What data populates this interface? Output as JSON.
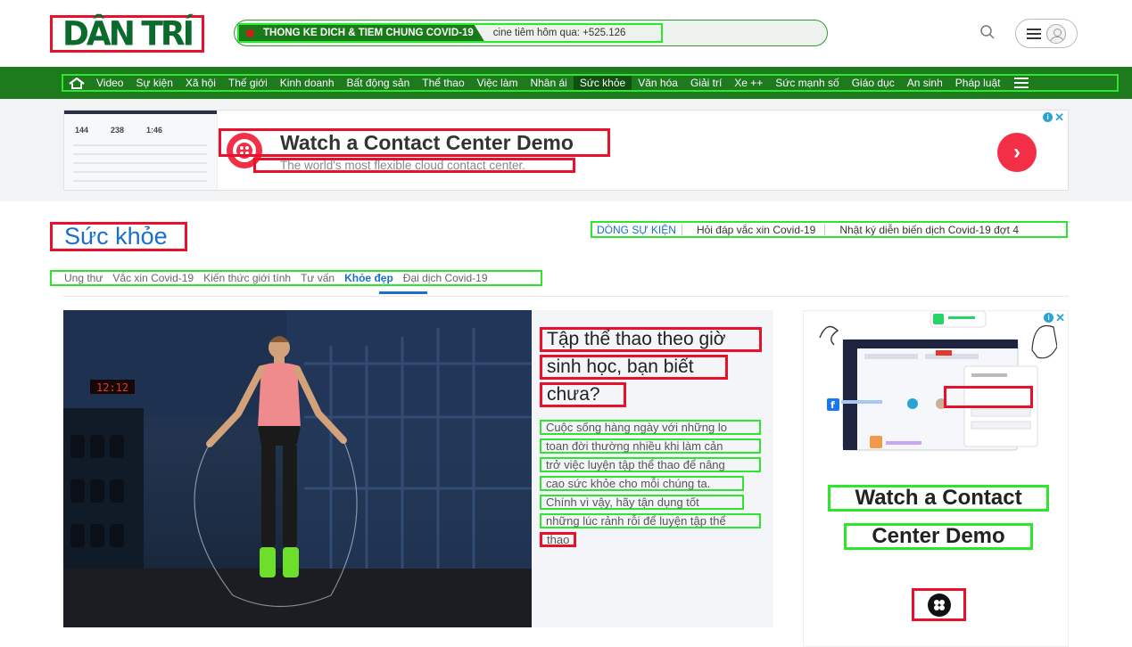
{
  "header": {
    "logo_text": "DÂN TRÍ",
    "covid_label": "THONG KE DICH & TIEM CHUNG COVID-19",
    "covid_ticker": "cine tiêm hôm qua: +525.126"
  },
  "nav": {
    "items": [
      {
        "label": "Video"
      },
      {
        "label": "Sự kiện"
      },
      {
        "label": "Xã hội"
      },
      {
        "label": "Thế giới"
      },
      {
        "label": "Kinh doanh"
      },
      {
        "label": "Bất động sản"
      },
      {
        "label": "Thể thao"
      },
      {
        "label": "Việc làm"
      },
      {
        "label": "Nhân ái"
      },
      {
        "label": "Sức khỏe",
        "active": true
      },
      {
        "label": "Văn hóa"
      },
      {
        "label": "Giải trí"
      },
      {
        "label": "Xe ++"
      },
      {
        "label": "Sức mạnh số"
      },
      {
        "label": "Giáo dục"
      },
      {
        "label": "An sinh"
      },
      {
        "label": "Pháp luật"
      }
    ]
  },
  "banner_ad": {
    "title": "Watch a Contact Center Demo",
    "subtitle": "The world's most flexible cloud contact center.",
    "thumb_numbers": [
      "144",
      "238",
      "1:46"
    ]
  },
  "section": {
    "title": "Sức khỏe",
    "events_label": "DÒNG SỰ KIỆN",
    "events": [
      "Hỏi đáp vắc xin Covid-19",
      "Nhật ký diễn biến dịch Covid-19 đợt 4"
    ],
    "subtabs": [
      {
        "label": "Ung thư"
      },
      {
        "label": "Vắc xin Covid-19"
      },
      {
        "label": "Kiến thức giới tính"
      },
      {
        "label": "Tư vấn"
      },
      {
        "label": "Khỏe đẹp",
        "active": true
      },
      {
        "label": "Đại dịch Covid-19"
      }
    ]
  },
  "article": {
    "title_lines": [
      "Tập thể thao theo giờ",
      "sinh học, bạn biết",
      "chưa?"
    ],
    "sapo_lines": [
      "Cuộc sống hàng ngày với những lo",
      "toan đời thường nhiều khi làm cản",
      "trở việc luyện tập thể thao để nâng",
      "cao sức khỏe cho mỗi chúng ta.",
      "Chính vì vậy, hãy tận dụng tốt",
      "những lúc rảnh rỗi để luyện tập thể"
    ],
    "sapo_last": "thao",
    "image_clock": "12:12"
  },
  "side_ad": {
    "title_line1": "Watch a Contact",
    "title_line2": "Center Demo"
  },
  "colors": {
    "brand_green": "#1d7a1d",
    "link_blue": "#1a6fc9",
    "ad_red": "#f22f46"
  },
  "icons": [
    "home-icon",
    "search-icon",
    "menu-icon",
    "user-icon",
    "chevron-right-icon",
    "ad-info-icon",
    "ad-close-icon",
    "whatsapp-icon",
    "facebook-icon"
  ]
}
